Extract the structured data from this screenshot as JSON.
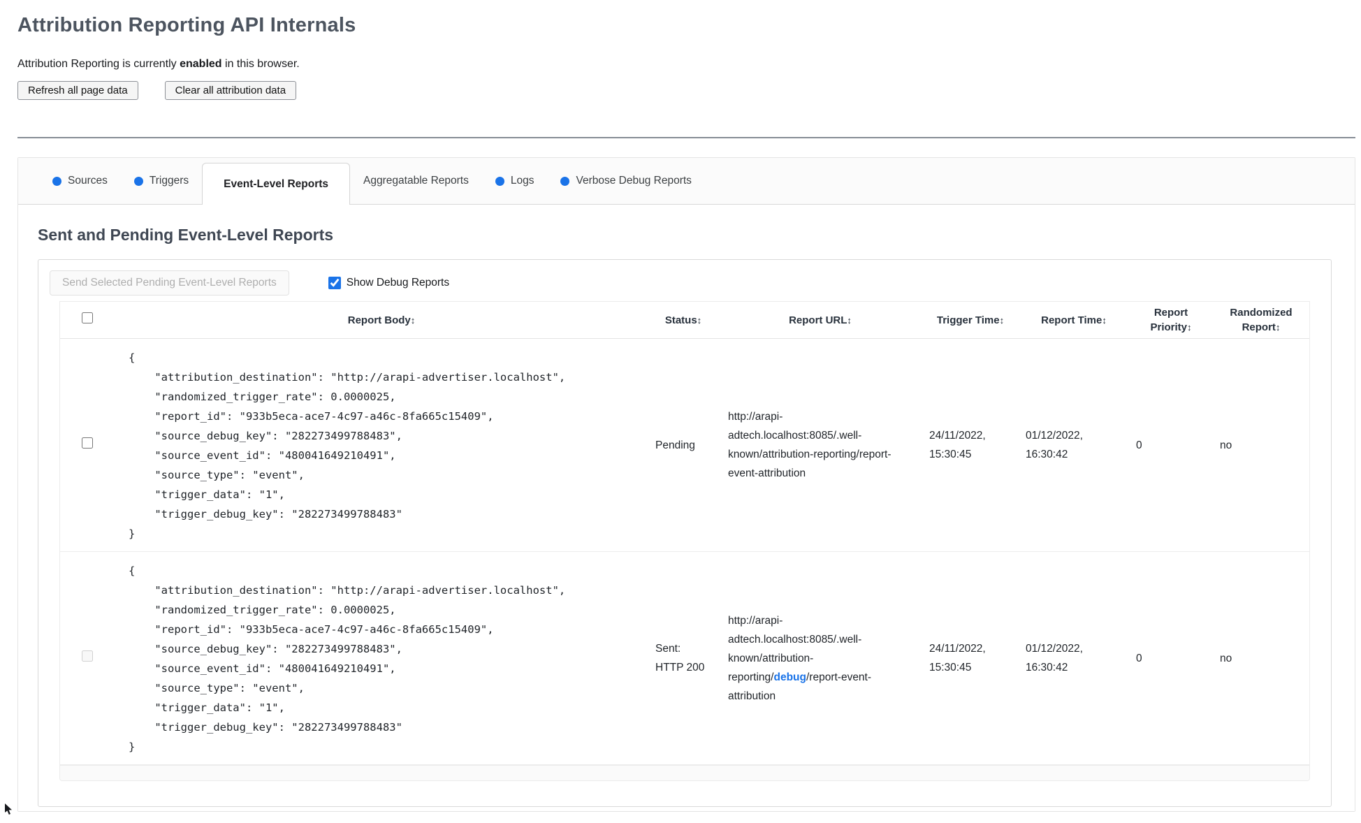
{
  "colors": {
    "accent": "#1a73e8"
  },
  "page": {
    "title": "Attribution Reporting API Internals",
    "status_prefix": "Attribution Reporting is currently ",
    "status_bold": "enabled",
    "status_suffix": " in this browser.",
    "refresh_button": "Refresh all page data",
    "clear_button": "Clear all attribution data"
  },
  "tabs": {
    "dot_color": "#1a73e8",
    "items": [
      {
        "label": "Sources",
        "dot": true,
        "active": false
      },
      {
        "label": "Triggers",
        "dot": true,
        "active": false
      },
      {
        "label": "Event-Level Reports",
        "dot": false,
        "active": true
      },
      {
        "label": "Aggregatable Reports",
        "dot": false,
        "active": false
      },
      {
        "label": "Logs",
        "dot": true,
        "active": false
      },
      {
        "label": "Verbose Debug Reports",
        "dot": true,
        "active": false
      }
    ]
  },
  "section": {
    "heading": "Sent and Pending Event-Level Reports",
    "send_button": "Send Selected Pending Event-Level Reports",
    "send_button_enabled": false,
    "show_debug_label": "Show Debug Reports",
    "show_debug_checked": true,
    "checkbox_color": "#1a73e8"
  },
  "table": {
    "sort_indicator": "↕",
    "select_all_checked": false,
    "link_color": "#1a73e8",
    "columns": [
      "Report Body",
      "Status",
      "Report URL",
      "Trigger Time",
      "Report Time",
      "Report Priority",
      "Randomized Report"
    ],
    "rows": [
      {
        "checkbox_enabled": true,
        "checkbox_checked": false,
        "report_body": "{\n    \"attribution_destination\": \"http://arapi-advertiser.localhost\",\n    \"randomized_trigger_rate\": 0.0000025,\n    \"report_id\": \"933b5eca-ace7-4c97-a46c-8fa665c15409\",\n    \"source_debug_key\": \"282273499788483\",\n    \"source_event_id\": \"480041649210491\",\n    \"source_type\": \"event\",\n    \"trigger_data\": \"1\",\n    \"trigger_debug_key\": \"282273499788483\"\n}",
        "status": "Pending",
        "url_prefix": "http://arapi-adtech.localhost:8085/.well-known/attribution-reporting/report-event-attribution",
        "url_link": "",
        "url_suffix": "",
        "trigger_time": "24/11/2022, 15:30:45",
        "report_time": "01/12/2022, 16:30:42",
        "report_priority": "0",
        "randomized_report": "no"
      },
      {
        "checkbox_enabled": false,
        "checkbox_checked": false,
        "report_body": "{\n    \"attribution_destination\": \"http://arapi-advertiser.localhost\",\n    \"randomized_trigger_rate\": 0.0000025,\n    \"report_id\": \"933b5eca-ace7-4c97-a46c-8fa665c15409\",\n    \"source_debug_key\": \"282273499788483\",\n    \"source_event_id\": \"480041649210491\",\n    \"source_type\": \"event\",\n    \"trigger_data\": \"1\",\n    \"trigger_debug_key\": \"282273499788483\"\n}",
        "status": "Sent: HTTP 200",
        "url_prefix": "http://arapi-adtech.localhost:8085/.well-known/attribution-reporting/",
        "url_link": "debug",
        "url_suffix": "/report-event-attribution",
        "trigger_time": "24/11/2022, 15:30:45",
        "report_time": "01/12/2022, 16:30:42",
        "report_priority": "0",
        "randomized_report": "no"
      }
    ]
  }
}
